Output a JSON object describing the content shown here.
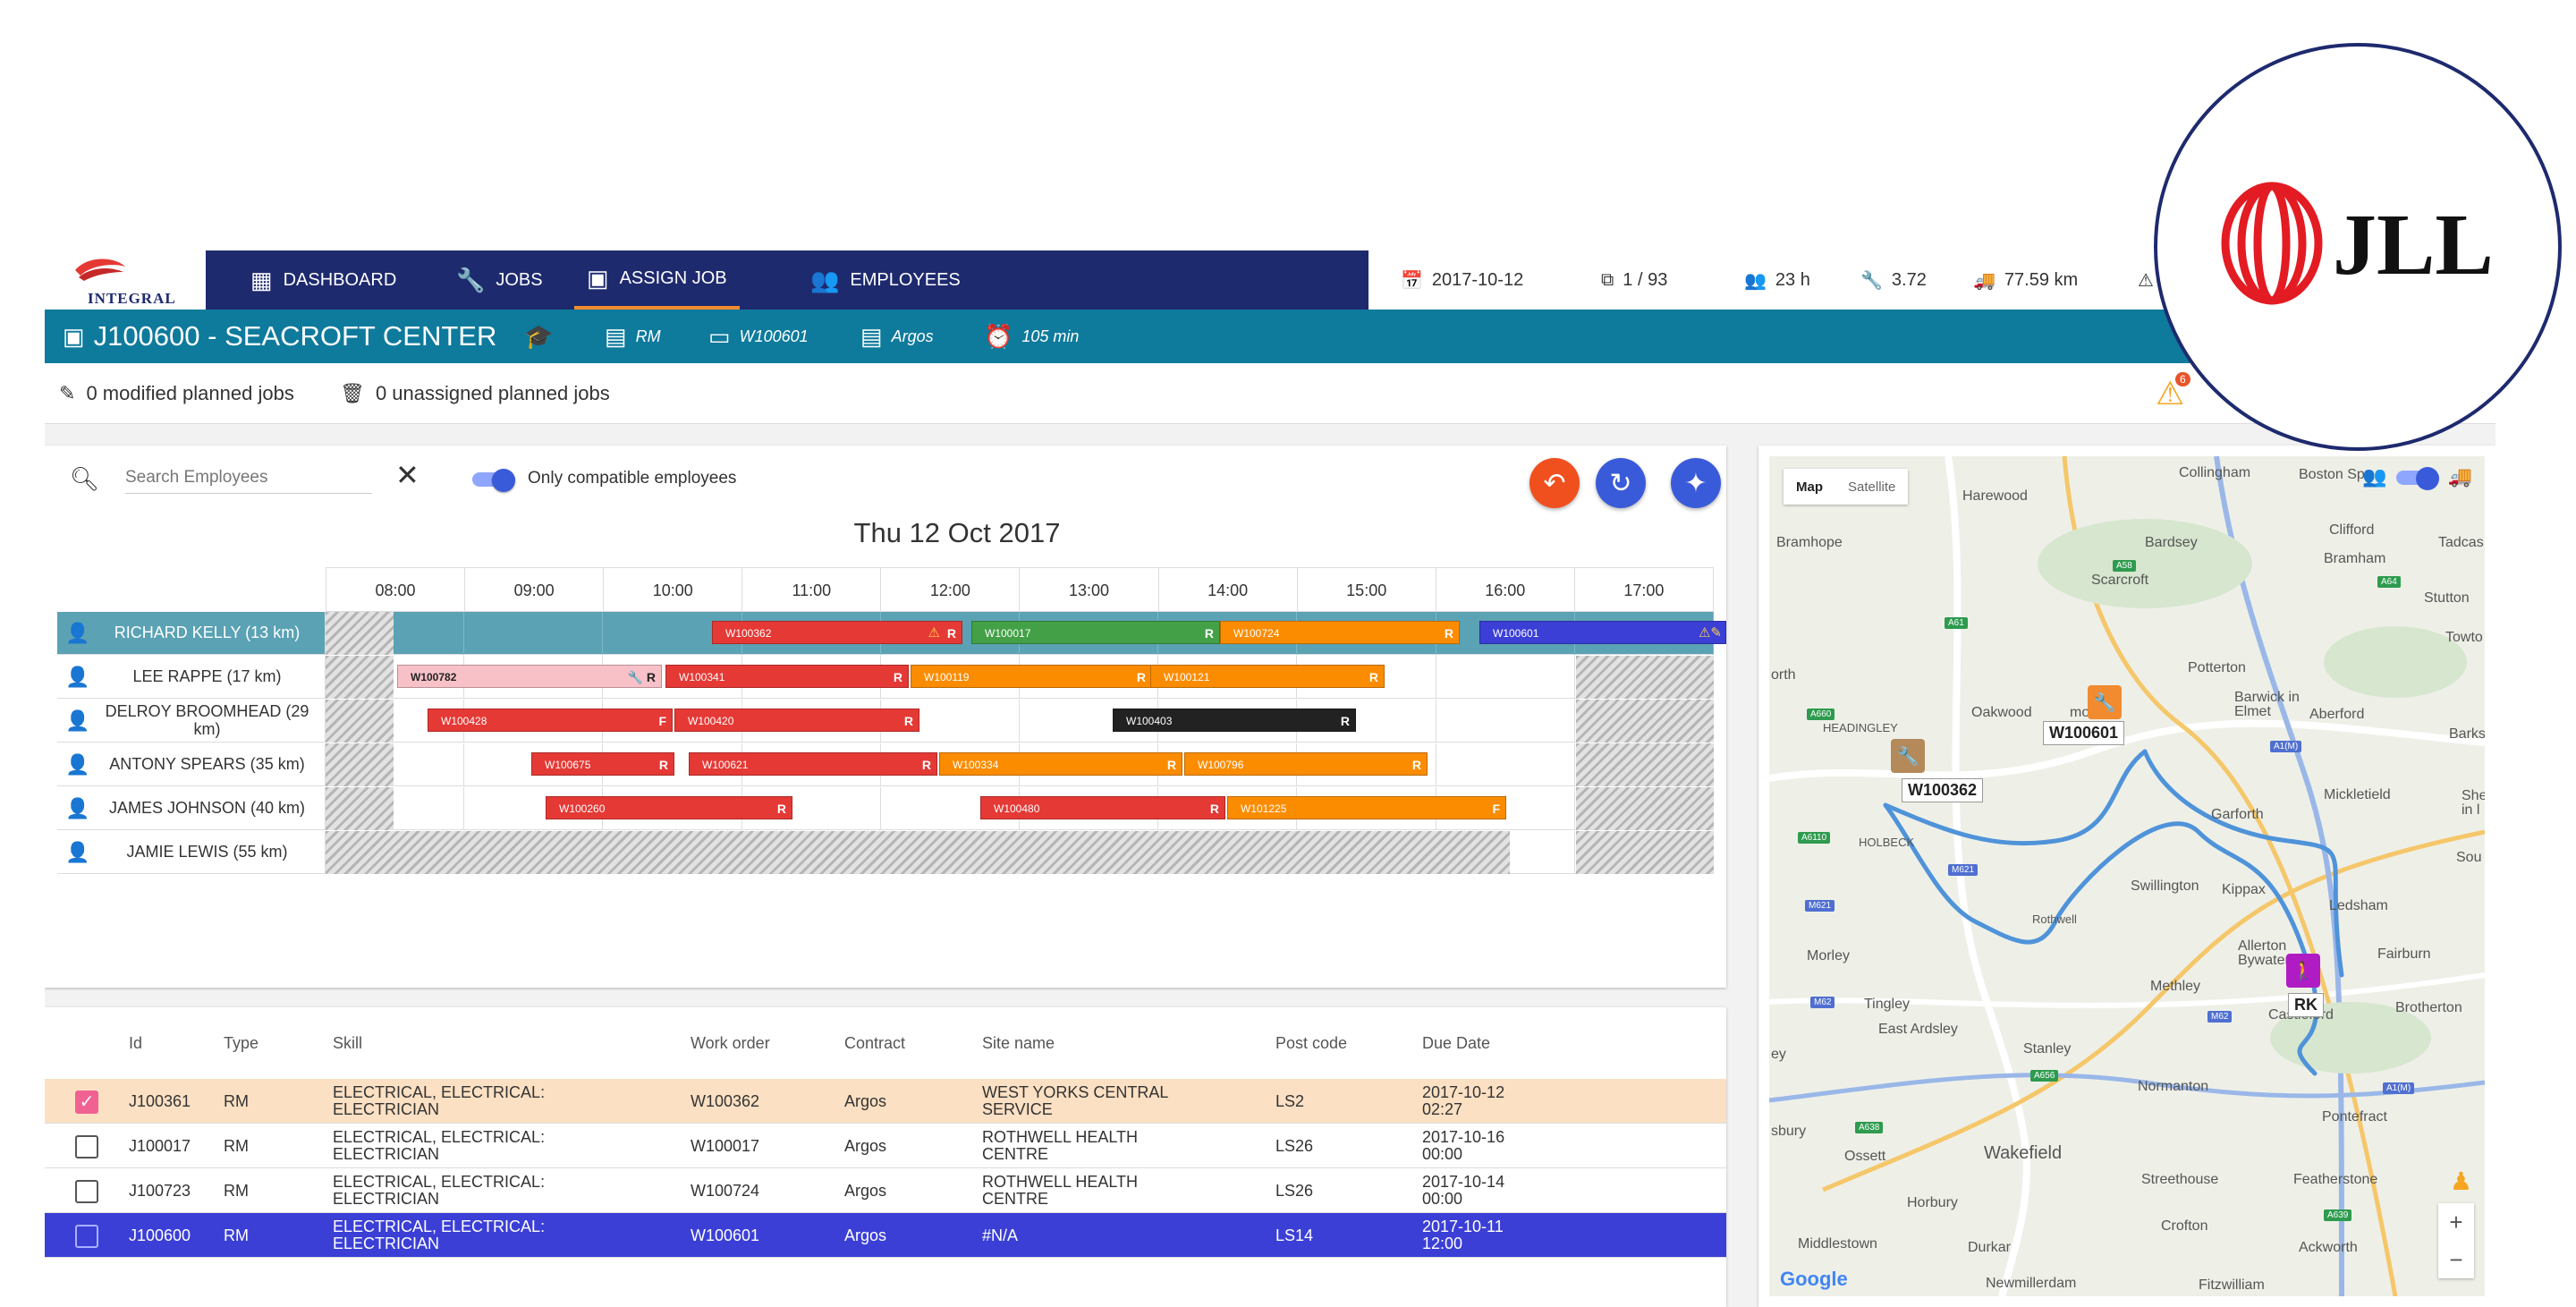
{
  "brand": {
    "logo_text": "INTEGRAL"
  },
  "nav": {
    "items": [
      {
        "label": "DASHBOARD",
        "icon": "dashboard-icon"
      },
      {
        "label": "JOBS",
        "icon": "wrench-icon"
      },
      {
        "label": "ASSIGN JOB",
        "icon": "assign-job-icon"
      },
      {
        "label": "EMPLOYEES",
        "icon": "employees-icon"
      }
    ],
    "stats": {
      "date": "2017-10-12",
      "pages": "1 / 93",
      "hours": "23 h",
      "tools": "3.72",
      "distance": "77.59 km"
    }
  },
  "jobbar": {
    "title": "J100600 - SEACROFT CENTER",
    "type": "RM",
    "work_order": "W100601",
    "contract": "Argos",
    "duration": "105 min"
  },
  "modbar": {
    "modified": "0 modified planned jobs",
    "unassigned": "0 unassigned planned jobs",
    "warning_count": "6"
  },
  "gantt": {
    "search_placeholder": "Search Employees",
    "compat_label": "Only compatible employees",
    "date": "Thu 12 Oct 2017",
    "hours": [
      "08:00",
      "09:00",
      "10:00",
      "11:00",
      "12:00",
      "13:00",
      "14:00",
      "15:00",
      "16:00",
      "17:00"
    ],
    "employees": [
      {
        "name": "RICHARD KELLY (13 km)"
      },
      {
        "name": "LEE RAPPE (17 km)"
      },
      {
        "name": "DELROY BROOMHEAD (29 km)"
      },
      {
        "name": "ANTONY SPEARS (35 km)"
      },
      {
        "name": "JAMES JOHNSON (40 km)"
      },
      {
        "name": "JAMIE LEWIS (55 km)"
      }
    ],
    "jobs": {
      "r0": [
        {
          "id": "W100362",
          "flag": "R"
        },
        {
          "id": "W100017",
          "flag": "R"
        },
        {
          "id": "W100724",
          "flag": "R"
        },
        {
          "id": "W100601",
          "flag": ""
        }
      ],
      "r1": [
        {
          "id": "W100782",
          "flag": "R"
        },
        {
          "id": "W100341",
          "flag": "R"
        },
        {
          "id": "W100119",
          "flag": "R"
        },
        {
          "id": "W100121",
          "flag": "R"
        }
      ],
      "r2": [
        {
          "id": "W100428",
          "flag": "F"
        },
        {
          "id": "W100420",
          "flag": "R"
        },
        {
          "id": "W100403",
          "flag": "R"
        }
      ],
      "r3": [
        {
          "id": "W100675",
          "flag": "R"
        },
        {
          "id": "W100621",
          "flag": "R"
        },
        {
          "id": "W100334",
          "flag": "R"
        },
        {
          "id": "W100796",
          "flag": "R"
        }
      ],
      "r4": [
        {
          "id": "W100260",
          "flag": "R"
        },
        {
          "id": "W100480",
          "flag": "R"
        },
        {
          "id": "W101225",
          "flag": "F"
        }
      ]
    }
  },
  "table": {
    "headers": {
      "id": "Id",
      "type": "Type",
      "skill": "Skill",
      "work_order": "Work order",
      "contract": "Contract",
      "site": "Site name",
      "post": "Post code",
      "due": "Due Date"
    },
    "rows": [
      {
        "id": "J100361",
        "type": "RM",
        "skill1": "ELECTRICAL, ELECTRICAL:",
        "skill2": "ELECTRICIAN",
        "wo": "W100362",
        "contract": "Argos",
        "site1": "WEST YORKS CENTRAL",
        "site2": "SERVICE",
        "post": "LS2",
        "due1": "2017-10-12",
        "due2": "02:27"
      },
      {
        "id": "J100017",
        "type": "RM",
        "skill1": "ELECTRICAL, ELECTRICAL:",
        "skill2": "ELECTRICIAN",
        "wo": "W100017",
        "contract": "Argos",
        "site1": "ROTHWELL HEALTH",
        "site2": "CENTRE",
        "post": "LS26",
        "due1": "2017-10-16",
        "due2": "00:00"
      },
      {
        "id": "J100723",
        "type": "RM",
        "skill1": "ELECTRICAL, ELECTRICAL:",
        "skill2": "ELECTRICIAN",
        "wo": "W100724",
        "contract": "Argos",
        "site1": "ROTHWELL HEALTH",
        "site2": "CENTRE",
        "post": "LS26",
        "due1": "2017-10-14",
        "due2": "00:00"
      },
      {
        "id": "J100600",
        "type": "RM",
        "skill1": "ELECTRICAL, ELECTRICAL:",
        "skill2": "ELECTRICIAN",
        "wo": "W100601",
        "contract": "Argos",
        "site1": "#N/A",
        "site2": "",
        "post": "LS14",
        "due1": "2017-10-11",
        "due2": "12:00"
      }
    ]
  },
  "map": {
    "type_map": "Map",
    "type_satellite": "Satellite",
    "places": [
      "Collingham",
      "Boston Spa",
      "Harewood",
      "Clifford",
      "Bramhope",
      "Bardsey",
      "Bramham",
      "Tadcas",
      "Scarcroft",
      "Stutton",
      "Potterton",
      "Towto",
      "Barwick in Elmet",
      "Aberford",
      "Oakwood",
      "moor",
      "HEADINGLEY",
      "Barkst",
      "Mickletield",
      "Garforth",
      "HOLBECK",
      "Swillington",
      "Kippax",
      "Ledsham",
      "Rothwell",
      "Allerton Bywater",
      "Fairburn",
      "Morley",
      "Methley",
      "Castleford",
      "Tingley",
      "East Ardsley",
      "Brotherton",
      "Stanley",
      "Normanton",
      "Pontefract",
      "Wakefield",
      "Ossett",
      "Streethouse",
      "Featherstone",
      "Horbury",
      "Crofton",
      "Middlestown",
      "Durkar",
      "Ackworth",
      "Newmillerdam",
      "Fitzwilliam",
      "sbury",
      "orth",
      "ey",
      "Sou",
      "She in l"
    ],
    "markers": {
      "m1": "W100601",
      "m2": "W100362",
      "m3": "RK"
    },
    "google": "Google"
  },
  "badge": {
    "text": "JLL"
  },
  "colors": {
    "nav": "#1e2a6e",
    "jobbar": "#0e7a9c",
    "accent": "#3a5bd9",
    "warn": "#f5a623"
  }
}
